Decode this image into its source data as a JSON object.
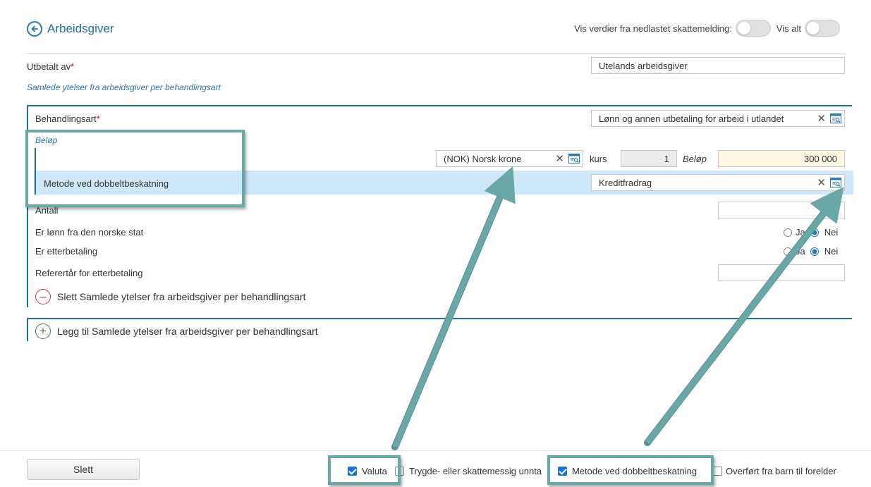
{
  "header": {
    "title": "Arbeidsgiver",
    "show_downloaded_label": "Vis verdier fra nedlastet skattemelding:",
    "show_all_label": "Vis alt"
  },
  "utbetalt": {
    "label": "Utbetalt av",
    "required": "*",
    "value": "Utelands arbeidsgiver"
  },
  "section_link": "Samlede ytelser fra arbeidsgiver per behandlingsart",
  "behandlingsart": {
    "label": "Behandlingsart",
    "required": "*",
    "value": "Lønn og annen utbetaling for arbeid i utlandet"
  },
  "belop_group": {
    "title": "Beløp",
    "currency": "(NOK) Norsk krone",
    "kurs_label": "kurs",
    "kurs_value": "1",
    "belop_label": "Beløp",
    "belop_value": "300 000"
  },
  "metode": {
    "label": "Metode ved dobbeltbeskatning",
    "value": "Kreditfradrag"
  },
  "antall": {
    "label": "Antall",
    "value": ""
  },
  "norsk_stat": {
    "label": "Er lønn fra den norske stat",
    "ja": "Ja",
    "nei": "Nei",
    "selected": "Nei"
  },
  "etterbetaling": {
    "label": "Er etterbetaling",
    "ja": "Ja",
    "nei": "Nei",
    "selected": "Nei"
  },
  "refereraar": {
    "label": "Referertår for etterbetaling",
    "value": ""
  },
  "delete_label": "Slett Samlede ytelser fra arbeidsgiver per behandlingsart",
  "add_label": "Legg til Samlede ytelser fra arbeidsgiver per behandlingsart",
  "footer": {
    "slett_button": "Slett",
    "checkboxes": [
      {
        "label": "Valuta",
        "checked": true
      },
      {
        "label": "Trygde- eller skattemessig unnta",
        "checked": false
      },
      {
        "label": "Metode ved dobbeltbeskatning",
        "checked": true
      },
      {
        "label": "Overført fra barn til forelder",
        "checked": false
      }
    ]
  },
  "colors": {
    "accent": "#1f6f9f",
    "highlight_row": "#cfe8f9",
    "annotation": "#6aa7a7",
    "belop_field": "#fff8e5"
  }
}
